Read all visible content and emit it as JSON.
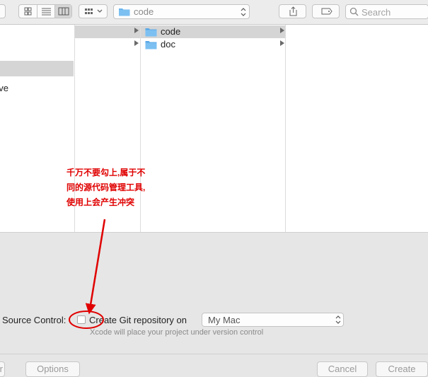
{
  "toolbar": {
    "path_popup": {
      "label": "code"
    },
    "search": {
      "placeholder": "Search"
    }
  },
  "sidebar": {
    "partial_item": "rive"
  },
  "columns": [
    {
      "items": [
        {
          "name": "",
          "selected": true
        },
        {
          "name": "",
          "selected": false
        }
      ]
    },
    {
      "items": [
        {
          "name": "code",
          "selected": true
        },
        {
          "name": "doc",
          "selected": false
        }
      ]
    }
  ],
  "source_control": {
    "label": "Source Control:",
    "checkbox_label": "Create Git repository on",
    "checked": false,
    "location": "My Mac",
    "helper": "Xcode will place your project under version control"
  },
  "footer": {
    "left_button": "r",
    "options_button": "Options",
    "cancel_button": "Cancel",
    "create_button": "Create"
  },
  "annotation": {
    "lines": [
      "千万不要勾上,属于不",
      "同的源代码管理工具,",
      "使用上会产生冲突"
    ],
    "color": "#e00000"
  },
  "colors": {
    "folder": "#6ab4ee",
    "selection": "#d5d5d5"
  }
}
